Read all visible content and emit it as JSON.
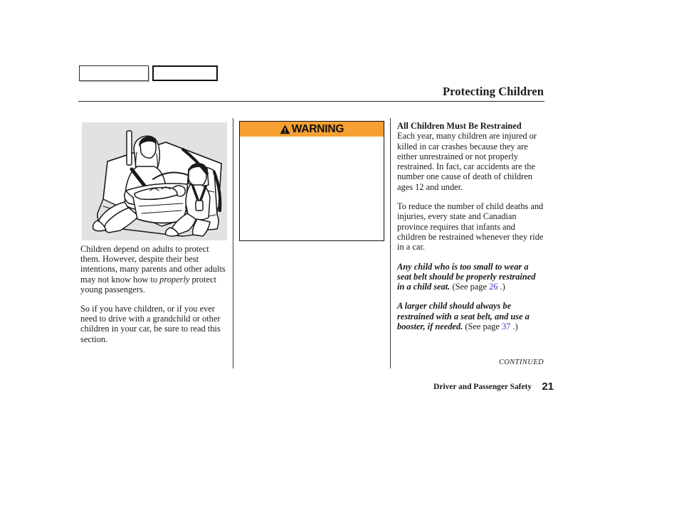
{
  "document": {
    "title": "Protecting Children",
    "page_number": "21",
    "section_footer": "Driver and Passenger Safety",
    "continued_label": "CONTINUED"
  },
  "tabs": [
    {
      "label": "",
      "name": "tab-box-1"
    },
    {
      "label": "",
      "name": "tab-box-2"
    }
  ],
  "illustration": {
    "alt": "Rear seat with adult holding infant carrier and child in a child safety seat",
    "background_color": "#e2e2e2",
    "line_color": "#1a1a1a"
  },
  "warning": {
    "label": "WARNING",
    "icon": "warning-triangle-icon",
    "header_color": "#f5a031",
    "body_text": ""
  },
  "left_column": {
    "paragraph_1_a": "Children depend on adults to protect them. However, despite their best intentions, many parents and other adults may not know how to ",
    "paragraph_1_italic": "properly",
    "paragraph_1_b": " protect young passengers.",
    "paragraph_2": "So if you have children, or if you ever need to drive with a grandchild or other children in your car, be sure to read this section."
  },
  "right_column": {
    "heading": "All Children Must Be Restrained",
    "paragraph_1": "Each year, many children are injured or killed in car crashes because they are either unrestrained or not properly restrained. In fact, car accidents are the number one cause of death of children ages 12 and under.",
    "paragraph_2": "To reduce the number of child deaths and injuries, every state and Canadian province requires that infants and children be restrained whenever they ride in a car.",
    "paragraph_3_bold": "Any child who is too small to wear a seat belt should be properly restrained in a child seat.",
    "paragraph_3_see": " (See page ",
    "paragraph_3_page": "26",
    "paragraph_3_end": " .)",
    "paragraph_4_bold": "A larger child should always be restrained with a seat belt, and use a booster, if needed.",
    "paragraph_4_see": " (See page ",
    "paragraph_4_page": "37",
    "paragraph_4_end": " .)"
  },
  "colors": {
    "link_blue": "#3333c4",
    "warning_orange": "#f5a031",
    "illustration_gray": "#e2e2e2"
  }
}
